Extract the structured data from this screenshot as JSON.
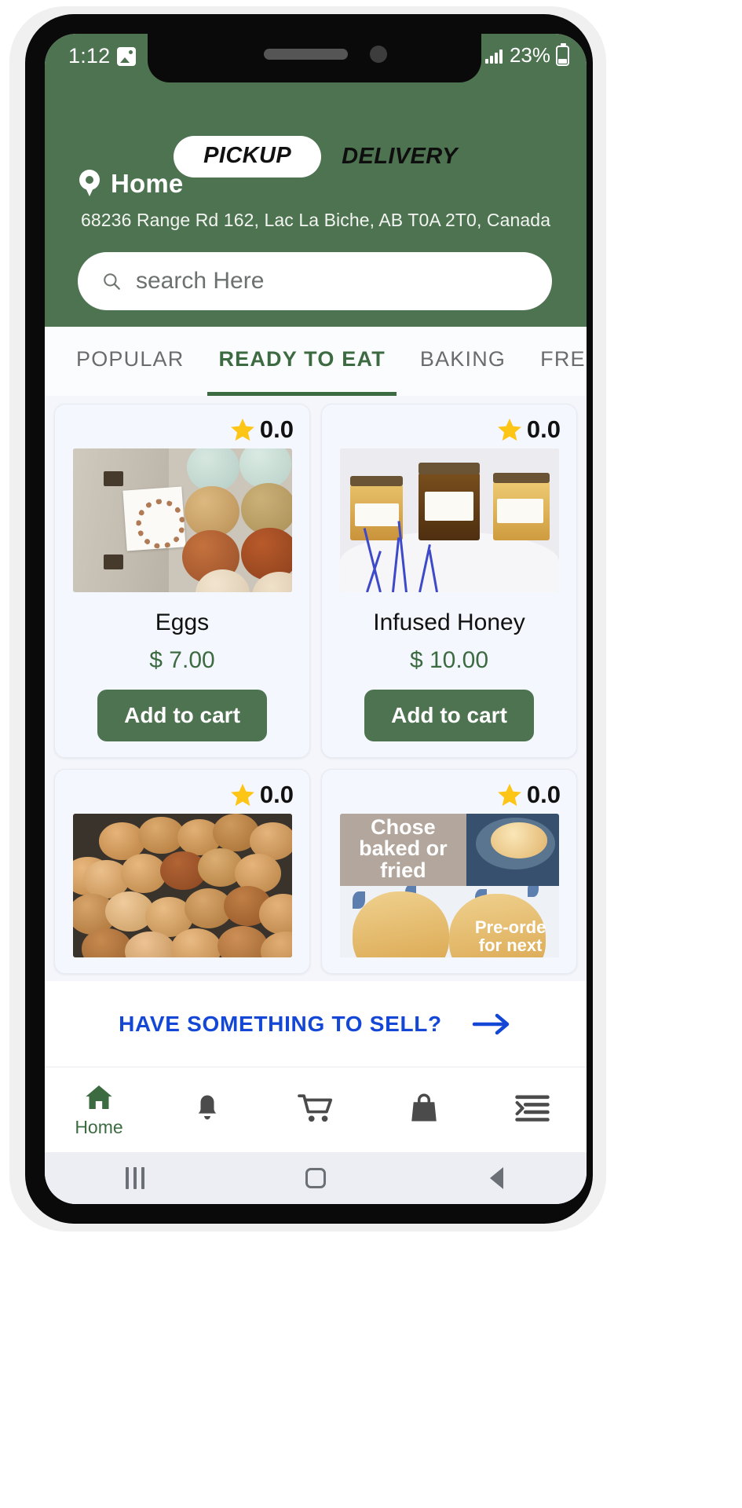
{
  "statusbar": {
    "time": "1:12",
    "image_icon": "image-icon",
    "network_icon": "signal-bars-icon",
    "data_icon": "data-transfer-icon",
    "battery_percent": "23%",
    "battery_icon": "battery-icon"
  },
  "header": {
    "background_color": "#4e7351",
    "mode_toggle": {
      "active": "PICKUP",
      "inactive": "DELIVERY"
    },
    "location": {
      "pin_icon": "location-pin-icon",
      "label": "Home",
      "address": "68236 Range Rd 162, Lac La Biche, AB T0A 2T0, Canada"
    },
    "search": {
      "icon": "search-icon",
      "placeholder": "search Here",
      "value": ""
    }
  },
  "tabs": {
    "active_index": 1,
    "accent_color": "#3d6b41",
    "items": [
      {
        "label": "POPULAR"
      },
      {
        "label": "READY TO EAT"
      },
      {
        "label": "BAKING"
      },
      {
        "label": "FRESH"
      }
    ]
  },
  "products": [
    {
      "name": "Eggs",
      "price": "$ 7.00",
      "rating": "0.0",
      "star_icon": "star-icon",
      "add_label": "Add to cart",
      "image": "eggs-carton-photo"
    },
    {
      "name": "Infused Honey",
      "price": "$ 10.00",
      "rating": "0.0",
      "star_icon": "star-icon",
      "add_label": "Add to cart",
      "image": "infused-honey-jars-photo"
    },
    {
      "name": "",
      "price": "",
      "rating": "0.0",
      "star_icon": "star-icon",
      "add_label": "",
      "image": "brown-eggs-pile-photo"
    },
    {
      "name": "",
      "price": "",
      "rating": "0.0",
      "star_icon": "star-icon",
      "add_label": "",
      "image": "baked-or-fried-promo-photo",
      "overlay_text_line1": "Chose",
      "overlay_text_line2": "baked or",
      "overlay_text_line3": "fried",
      "overlay_text_line4": "Pre-orde",
      "overlay_text_line5": "for next"
    }
  ],
  "sell_banner": {
    "text": "HAVE SOMETHING TO SELL?",
    "arrow_icon": "arrow-right-icon",
    "color": "#1447d6"
  },
  "bottom_nav": {
    "active_color": "#3d6b41",
    "items": [
      {
        "icon": "home-icon",
        "label": "Home"
      },
      {
        "icon": "bell-icon",
        "label": ""
      },
      {
        "icon": "cart-icon",
        "label": ""
      },
      {
        "icon": "bag-icon",
        "label": ""
      },
      {
        "icon": "menu-list-icon",
        "label": ""
      }
    ]
  },
  "android_nav": {
    "recents_icon": "recents-icon",
    "home_icon": "home-square-icon",
    "back_icon": "back-chevron-icon"
  }
}
